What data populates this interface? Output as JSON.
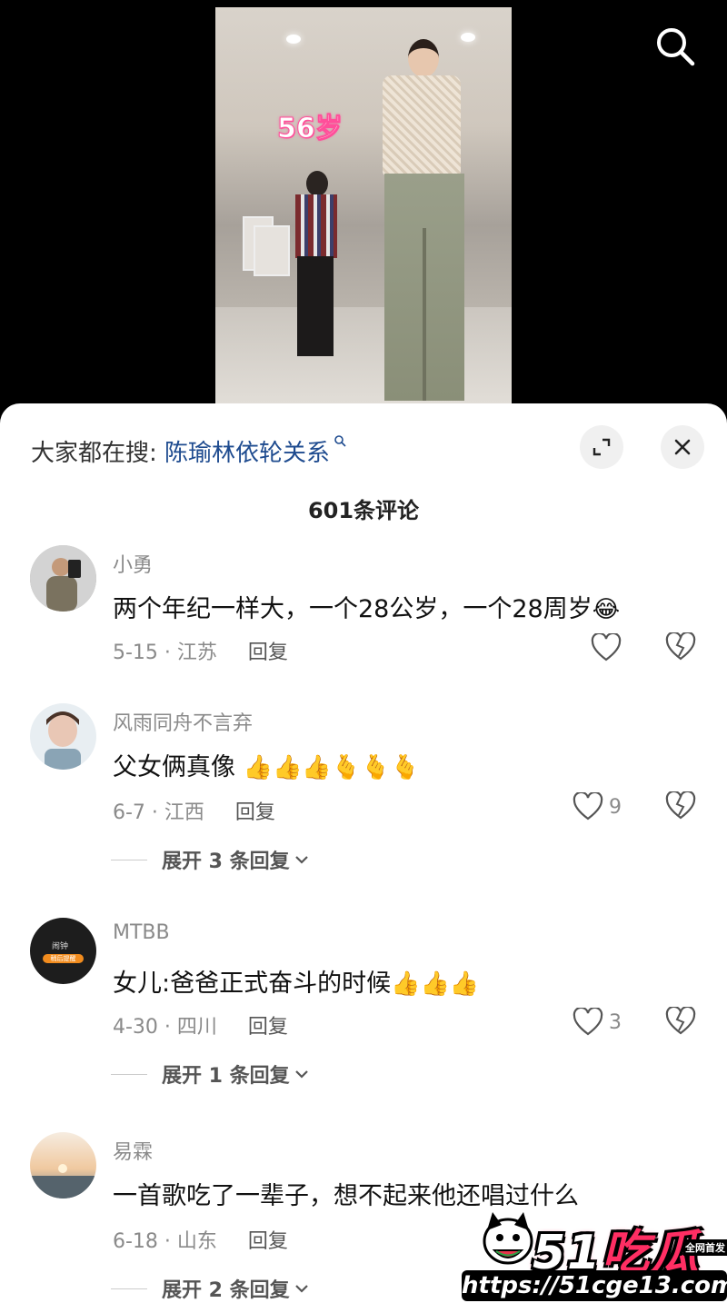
{
  "video": {
    "overlay_text": "56岁"
  },
  "panel": {
    "search_prefix": "大家都在搜:",
    "search_query": "陈瑜林依轮关系",
    "comment_count": "601条评论"
  },
  "comments": [
    {
      "user": "小勇",
      "text": "两个年纪一样大，一个28公岁，一个28周岁",
      "emoji": "😂",
      "date_region": "5-15 · 江苏",
      "reply_label": "回复",
      "likes": ""
    },
    {
      "user": "风雨同舟不言弃",
      "text": "父女俩真像",
      "emoji": "👍👍👍🫰🫰🫰",
      "date_region": "6-7 · 江西",
      "reply_label": "回复",
      "likes": "9",
      "expand_label": "展开 3 条回复"
    },
    {
      "user": "MTBB",
      "text": "女儿:爸爸正式奋斗的时候",
      "emoji": "👍👍👍",
      "date_region": "4-30 · 四川",
      "reply_label": "回复",
      "likes": "3",
      "expand_label": "展开 1 条回复"
    },
    {
      "user": "易霖",
      "text": "一首歌吃了一辈子，想不起来他还唱过什么",
      "emoji": "",
      "date_region": "6-18 · 山东",
      "reply_label": "回复",
      "likes": "",
      "expand_label": "展开 2 条回复"
    }
  ],
  "avatar_texts": {
    "mtbb_line1": "闹钟",
    "mtbb_line2": "稍后提醒"
  },
  "watermark": {
    "brand_num": "51",
    "brand_text": "吃瓜",
    "tag": "全网首发",
    "url": "https://51cge13.com"
  },
  "colors": {
    "link": "#1e4b8f",
    "meta": "#8a8a8a",
    "overlay_pink": "#ff4f9a"
  }
}
